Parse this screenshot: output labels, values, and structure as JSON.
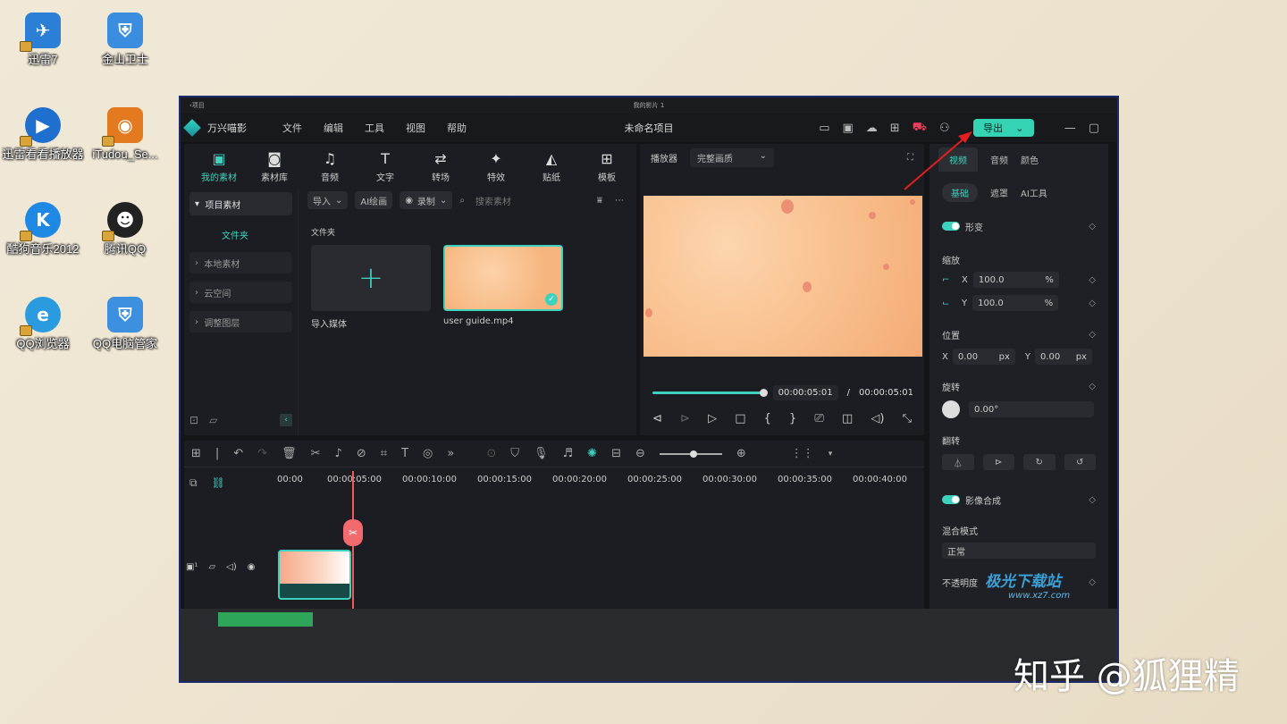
{
  "desktop_icons": [
    {
      "label": "迅雷7",
      "icon": "xunlei-icon",
      "color": "#2b7fd6"
    },
    {
      "label": "金山卫士",
      "icon": "jinshan-icon",
      "color": "#3b8de0"
    },
    {
      "label": "迅雷看看播放器",
      "icon": "xunlei-player-icon",
      "color": "#1f6fcf"
    },
    {
      "label": "iTudou_Se...",
      "icon": "itudou-icon",
      "color": "#e47a1f"
    },
    {
      "label": "酷狗音乐2012",
      "icon": "kugou-icon",
      "color": "#1e88e5"
    },
    {
      "label": "腾讯QQ",
      "icon": "qq-icon",
      "color": "#222222"
    },
    {
      "label": "QQ浏览器",
      "icon": "qq-browser-icon",
      "color": "#2b9be0"
    },
    {
      "label": "QQ电脑管家",
      "icon": "qq-guard-icon",
      "color": "#3d8fe0"
    }
  ],
  "mac_bar": {
    "left": "‹项目",
    "center": "我的影片 1"
  },
  "menubar": {
    "app_name": "万兴喵影",
    "menus": [
      "文件",
      "编辑",
      "工具",
      "视图",
      "帮助"
    ],
    "doc_title": "未命名项目",
    "export_label": "导出"
  },
  "media_tabs": [
    {
      "label": "我的素材",
      "icon": "my-media-icon",
      "glyph": "▣",
      "active": true
    },
    {
      "label": "素材库",
      "icon": "library-icon",
      "glyph": "◙",
      "active": false
    },
    {
      "label": "音频",
      "icon": "music-icon",
      "glyph": "♫",
      "active": false
    },
    {
      "label": "文字",
      "icon": "text-icon",
      "glyph": "T",
      "active": false
    },
    {
      "label": "转场",
      "icon": "transition-icon",
      "glyph": "⇄",
      "active": false
    },
    {
      "label": "特效",
      "icon": "effects-icon",
      "glyph": "✦",
      "active": false
    },
    {
      "label": "贴纸",
      "icon": "sticker-icon",
      "glyph": "◭",
      "active": false
    },
    {
      "label": "模板",
      "icon": "template-icon",
      "glyph": "⊞",
      "active": false
    }
  ],
  "side_nav": {
    "head": "项目素材",
    "sub": "文件夹",
    "items": [
      "本地素材",
      "云空间",
      "调整图层"
    ]
  },
  "media_toolbar": {
    "import": "导入",
    "ai": "AI绘画",
    "record": "录制",
    "search_placeholder": "搜索素材"
  },
  "folder_label": "文件夹",
  "thumbs": [
    {
      "name": "导入媒体",
      "kind": "import"
    },
    {
      "name": "user guide.mp4",
      "kind": "video"
    }
  ],
  "player": {
    "label": "播放器",
    "quality": "完整画质",
    "current_time": "00:00:05:01",
    "separator": "/",
    "total_time": "00:00:05:01",
    "progress": 1.0
  },
  "props": {
    "tabs": [
      "视频",
      "音频",
      "颜色"
    ],
    "sub_tabs": [
      "基础",
      "遮罩",
      "AI工具"
    ],
    "transform": "形变",
    "scale_label": "缩放",
    "scale_x": "100.0",
    "scale_y": "100.0",
    "percent": "%",
    "position_label": "位置",
    "pos_x": "0.00",
    "pos_y": "0.00",
    "px": "px",
    "rotate_label": "旋转",
    "rotate_value": "0.00°",
    "flip_label": "翻转",
    "composite": "影像合成",
    "blend_label": "混合模式",
    "blend_value": "正常",
    "opacity_label": "不透明度",
    "x": "X",
    "y": "Y"
  },
  "timeline": {
    "ticks": [
      "00:00",
      "00:00:05:00",
      "00:00:10:00",
      "00:00:15:00",
      "00:00:20:00",
      "00:00:25:00",
      "00:00:30:00",
      "00:00:35:00",
      "00:00:40:00"
    ]
  },
  "watermarks": {
    "site": "极光下载站",
    "url": "www.xz7.com",
    "zhihu": "知乎 @狐狸精"
  },
  "colors": {
    "accent": "#3fd1bd",
    "playhead": "#f2575b"
  }
}
